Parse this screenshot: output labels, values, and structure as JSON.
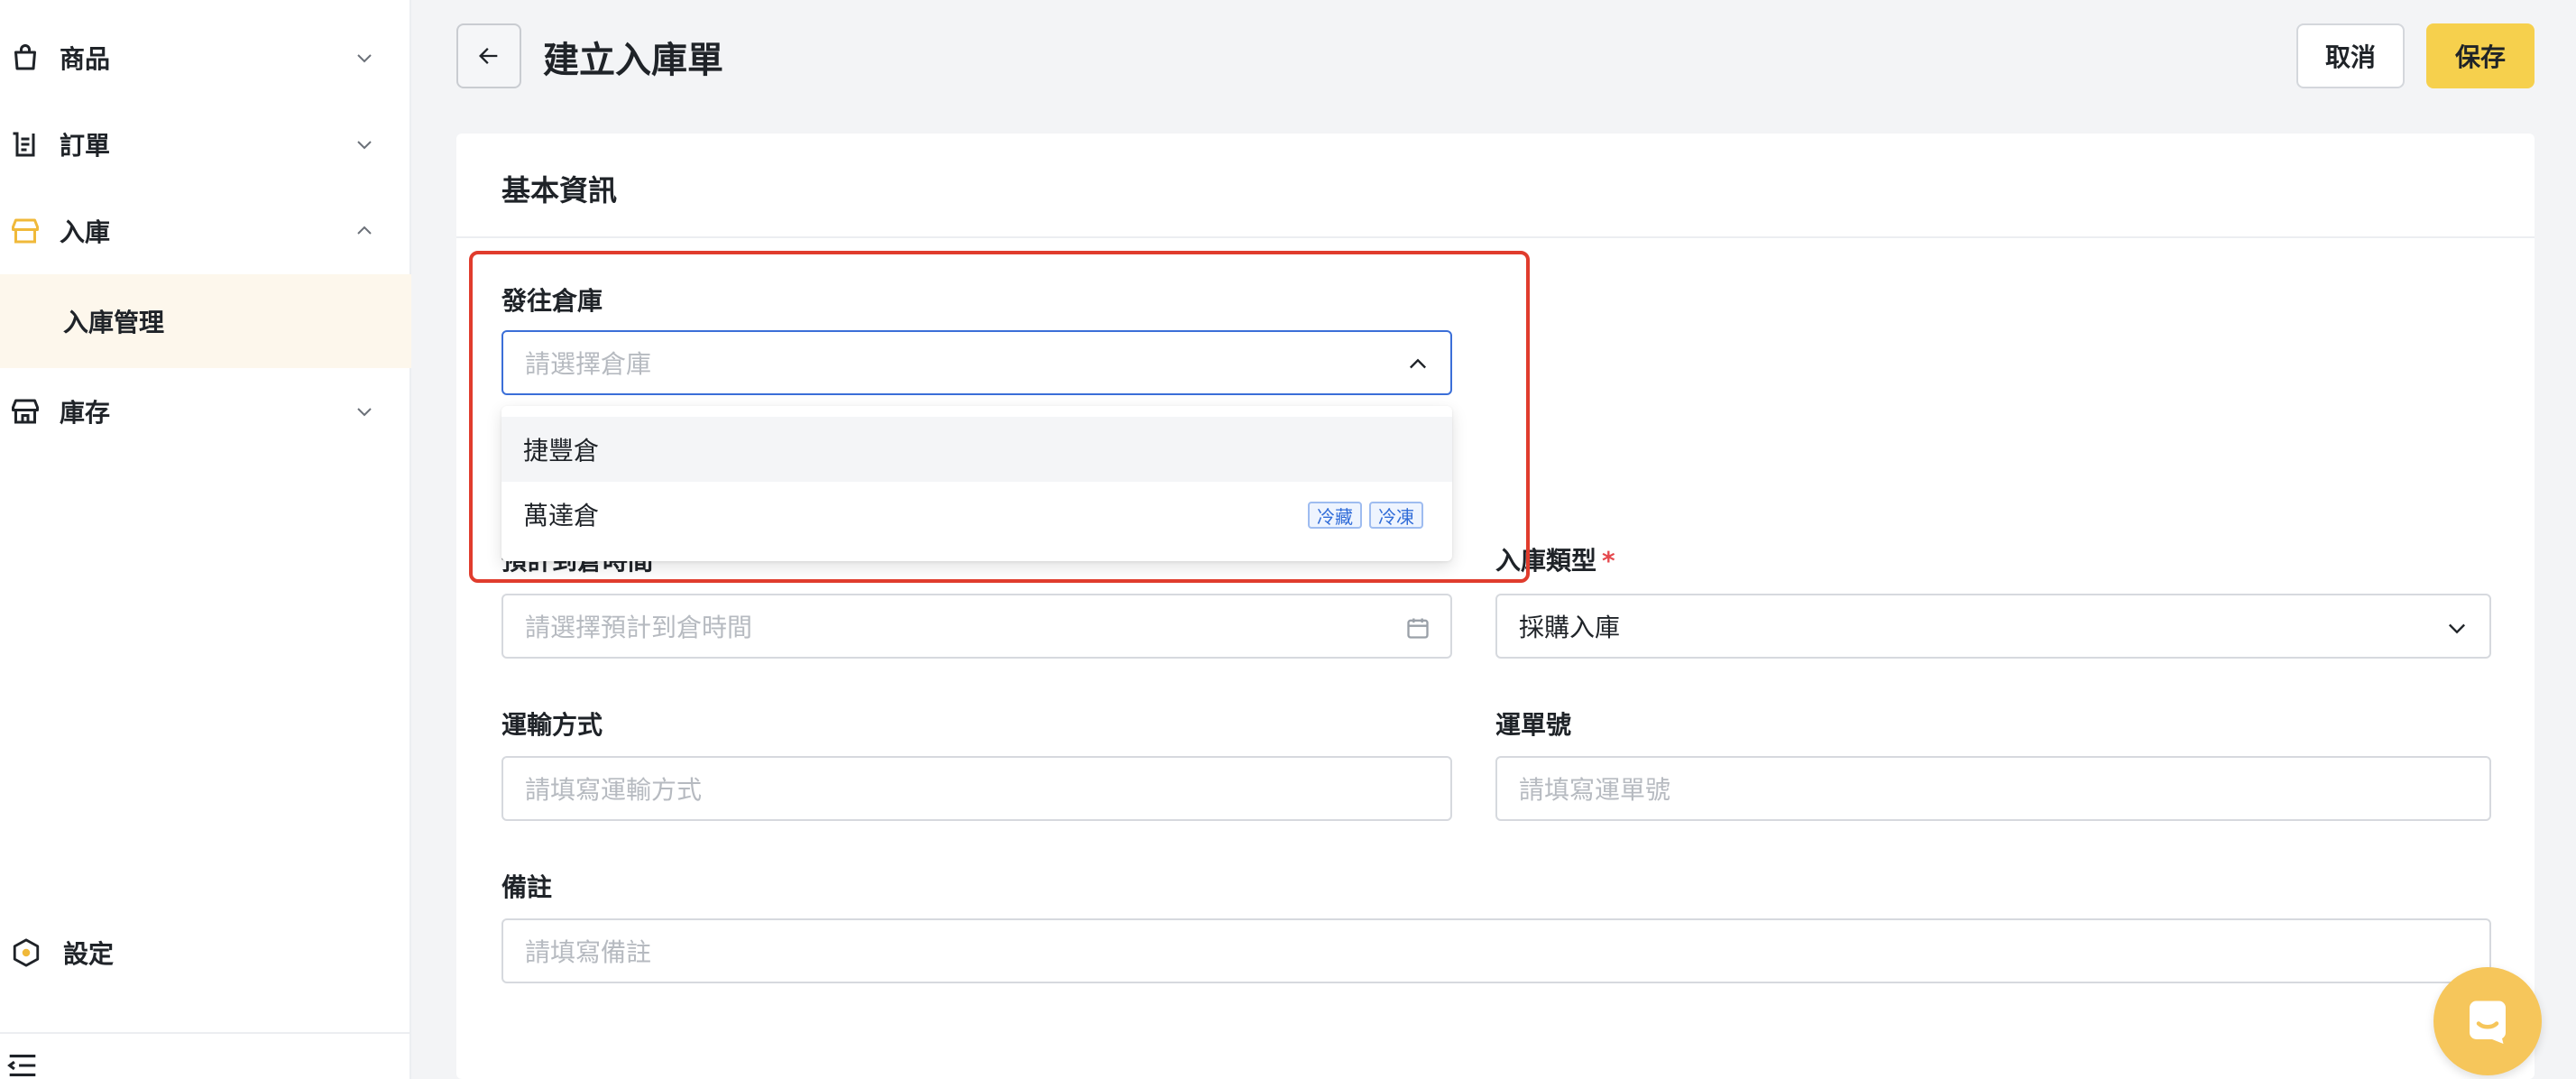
{
  "sidebar": {
    "items": [
      {
        "label": "商品",
        "icon": "shopping-bag-icon",
        "expanded": false
      },
      {
        "label": "訂單",
        "icon": "receipt-icon",
        "expanded": false
      },
      {
        "label": "入庫",
        "icon": "store-icon",
        "expanded": true,
        "active": true
      },
      {
        "label": "庫存",
        "icon": "warehouse-icon",
        "expanded": false
      }
    ],
    "sub_item": {
      "label": "入庫管理"
    },
    "settings": {
      "label": "設定",
      "icon": "hexagon-settings-icon"
    },
    "collapse_icon": "collapse-menu-icon"
  },
  "header": {
    "title": "建立入庫單",
    "cancel_label": "取消",
    "save_label": "保存"
  },
  "card": {
    "title": "基本資訊"
  },
  "form": {
    "warehouse": {
      "label": "發往倉庫",
      "placeholder": "請選擇倉庫"
    },
    "arrival_time": {
      "label": "預計到倉時間",
      "placeholder": "請選擇預計到倉時間"
    },
    "inbound_type": {
      "label": "入庫類型",
      "required_mark": "*",
      "value": "採購入庫"
    },
    "shipping_method": {
      "label": "運輸方式",
      "placeholder": "請填寫運輸方式"
    },
    "tracking_no": {
      "label": "運單號",
      "placeholder": "請填寫運單號"
    },
    "notes": {
      "label": "備註",
      "placeholder": "請填寫備註"
    }
  },
  "dropdown": {
    "options": [
      {
        "label": "捷豐倉",
        "tags": []
      },
      {
        "label": "萬達倉",
        "tags": [
          "冷藏",
          "冷凍"
        ]
      }
    ]
  },
  "colors": {
    "accent": "#f6d04d",
    "highlight": "#e03c2d",
    "focus": "#3b6fd8"
  }
}
